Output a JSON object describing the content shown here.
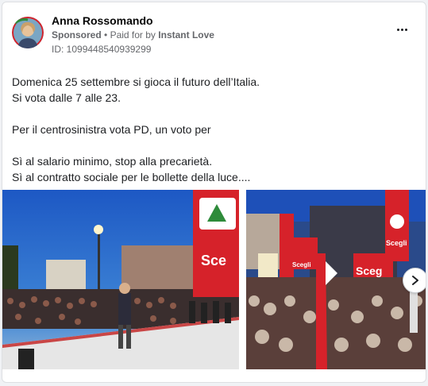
{
  "ad": {
    "advertiser_name": "Anna Rossomando",
    "sponsored_label": "Sponsored",
    "separator": "•",
    "paid_for_prefix": "Paid for by",
    "paid_for_name": "Instant Love",
    "ad_id": "ID: 1099448540939299"
  },
  "body": {
    "lines": [
      "Domenica 25 settembre si gioca il futuro dell’Italia.",
      "Si vota dalle 7 alle 23.",
      "Per il centrosinistra vota PD, un voto per",
      "Sì al salario minimo, stop alla precarietà.",
      "Sì al contratto sociale per le bollette della luce...."
    ]
  },
  "media": {
    "image1_alt": "",
    "image2_alt": "",
    "sign_text_left": "Sce",
    "sign_text_right_top": "Scegli",
    "sign_text_right_mid": "Scegli",
    "sign_text_right_banner": "Sceg"
  },
  "icons": {
    "more": "more-horizontal-icon",
    "next": "chevron-right-icon"
  },
  "colors": {
    "party_red": "#d6222a",
    "sky": "#1f5fc7",
    "text_primary": "#050505",
    "text_secondary": "#65676b"
  }
}
